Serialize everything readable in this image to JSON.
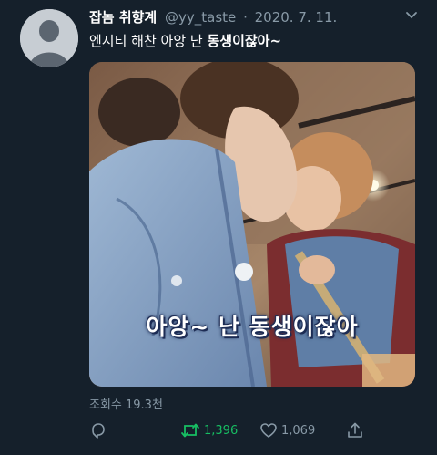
{
  "tweet": {
    "display_name": "잡놈 취향계",
    "handle": "@yy_taste",
    "separator": "·",
    "date": "2020. 7. 11.",
    "text_normal": "엔시티 해찬 아앙 난 ",
    "text_bold": "동생이잖아~",
    "media_caption": "아앙~ 난 동생이잖아",
    "views": "조회수 19.3천"
  },
  "actions": {
    "retweet_count": "1,396",
    "like_count": "1,069"
  },
  "icons": {
    "more": "chevron-down-icon",
    "reply": "reply-icon",
    "retweet": "retweet-icon",
    "like": "heart-icon",
    "share": "share-icon"
  },
  "colors": {
    "background": "#15202b",
    "secondary_text": "#8899a6",
    "retweet_active": "#17bf63"
  }
}
